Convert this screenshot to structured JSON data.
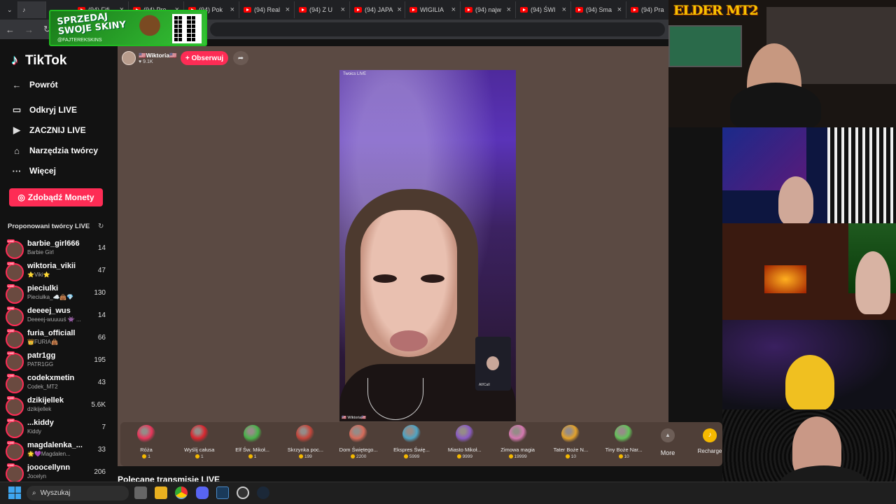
{
  "browser": {
    "tabs": [
      {
        "label": "(94) Fifi"
      },
      {
        "label": "(94) Pro"
      },
      {
        "label": "(94) Pok"
      },
      {
        "label": "(94) Real"
      },
      {
        "label": "(94) Z U"
      },
      {
        "label": "(94) JAPA"
      },
      {
        "label": "WIGILIA"
      },
      {
        "label": "(94) najw"
      },
      {
        "label": "(94) ŚWI"
      },
      {
        "label": "(94) Sma"
      },
      {
        "label": "(94) Pra"
      }
    ],
    "promo": {
      "line1": "SPRZEDAJ",
      "line2": "SWOJE SKINY",
      "sub": "@FAJTEREKSKINS"
    }
  },
  "tiktok": {
    "logo": "TikTok",
    "nav": {
      "back": "Powrót",
      "discover": "Odkryj LIVE",
      "go_live": "ZACZNIJ LIVE",
      "creator_tools": "Narzędzia twórcy",
      "more": "Więcej"
    },
    "coins_button": "Zdobądź Monety",
    "suggested_title": "Proponowani twórcy LIVE",
    "creators": [
      {
        "name": "barbie_girl666",
        "sub": "Barbie Girl",
        "count": "14"
      },
      {
        "name": "wiktoria_vikii",
        "sub": "⭐Viki⭐",
        "count": "47"
      },
      {
        "name": "pieciulki",
        "sub": "Pieciułka_☁️👜💎",
        "count": "130"
      },
      {
        "name": "deeeej_wus",
        "sub": "Deeeej-wuuuuś 👾 ...",
        "count": "14"
      },
      {
        "name": "furia_officiall",
        "sub": "👑FURIA👜",
        "count": "66"
      },
      {
        "name": "patr1gg",
        "sub": "PATR1GG",
        "count": "195"
      },
      {
        "name": "codekxmetin",
        "sub": "Codek_MT2",
        "count": "43"
      },
      {
        "name": "dzikijellek",
        "sub": "dzikijellek",
        "count": "5.6K"
      },
      {
        "name": "...kiddy",
        "sub": "Kiddy",
        "count": "7"
      },
      {
        "name": "magdalenka_...",
        "sub": "🌟💜Magdalen...",
        "count": "33"
      },
      {
        "name": "jooocellynn",
        "sub": "Jocelyn",
        "count": "206"
      }
    ],
    "host": {
      "name": "🇺🇸Wiktoria🇺🇸",
      "likes": "♥ 9.1K"
    },
    "follow_button": "+ Obserwuj",
    "video": {
      "title": "Twoics LIVE",
      "bottom": "🇺🇸 Wiktoria🇺🇸",
      "pip_label": "All!Call"
    },
    "gifts": [
      {
        "name": "Róża",
        "price": "1",
        "color": "#e8365b"
      },
      {
        "name": "Wyślij całusa",
        "price": "1",
        "color": "#d9262f"
      },
      {
        "name": "Elf Św. Mikoł...",
        "price": "1",
        "color": "#49b34a"
      },
      {
        "name": "Skrzynka poc...",
        "price": "199",
        "color": "#c4453a"
      },
      {
        "name": "Dom Świętego...",
        "price": "2200",
        "color": "#d66b5a"
      },
      {
        "name": "Ekspres Świę...",
        "price": "5999",
        "color": "#4fa4c4"
      },
      {
        "name": "Miasto Mikoł...",
        "price": "9999",
        "color": "#8a5cc4"
      },
      {
        "name": "Zimowa magia",
        "price": "19999",
        "color": "#d478b0"
      },
      {
        "name": "Tater Boże N...",
        "price": "10",
        "color": "#e2a22c"
      },
      {
        "name": "Tiny Boże Nar...",
        "price": "10",
        "color": "#64c25a"
      }
    ],
    "gift_more": "More",
    "recharge": "Recharge",
    "recommended": "Polecane transmisje LIVE"
  },
  "overlay": {
    "brand": "ELDER MT2"
  },
  "taskbar": {
    "search_placeholder": "Wyszukaj"
  }
}
